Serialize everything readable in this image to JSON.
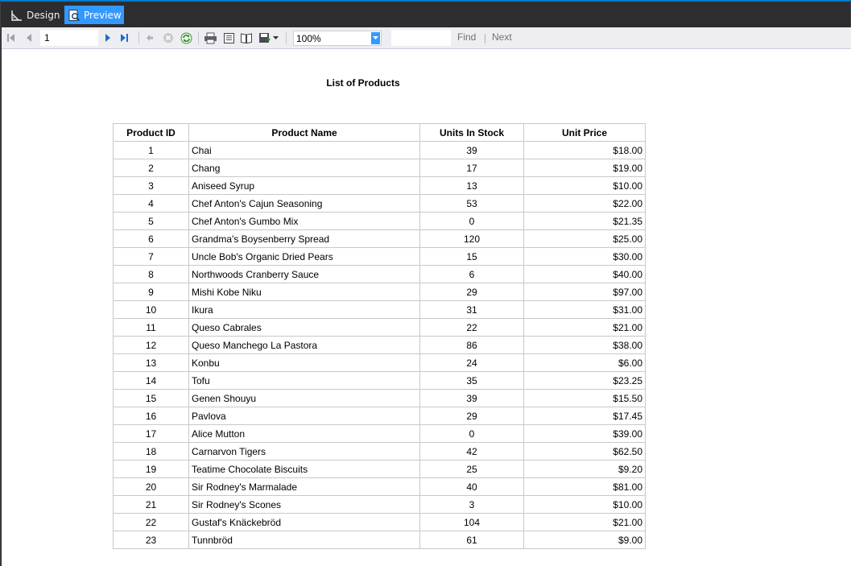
{
  "modes": {
    "design_label": "Design",
    "preview_label": "Preview"
  },
  "toolbar": {
    "page_value": "1",
    "zoom_value": "100%",
    "find_label": "Find",
    "next_label": "Next",
    "accent": "#3399ff"
  },
  "report": {
    "title": "List of Products",
    "columns": [
      "Product ID",
      "Product Name",
      "Units In Stock",
      "Unit Price"
    ],
    "rows": [
      {
        "id": "1",
        "name": "Chai",
        "stock": "39",
        "price": "$18.00"
      },
      {
        "id": "2",
        "name": "Chang",
        "stock": "17",
        "price": "$19.00"
      },
      {
        "id": "3",
        "name": "Aniseed Syrup",
        "stock": "13",
        "price": "$10.00"
      },
      {
        "id": "4",
        "name": "Chef Anton's Cajun Seasoning",
        "stock": "53",
        "price": "$22.00"
      },
      {
        "id": "5",
        "name": "Chef Anton's Gumbo Mix",
        "stock": "0",
        "price": "$21.35"
      },
      {
        "id": "6",
        "name": "Grandma's Boysenberry Spread",
        "stock": "120",
        "price": "$25.00"
      },
      {
        "id": "7",
        "name": "Uncle Bob's Organic Dried Pears",
        "stock": "15",
        "price": "$30.00"
      },
      {
        "id": "8",
        "name": "Northwoods Cranberry Sauce",
        "stock": "6",
        "price": "$40.00"
      },
      {
        "id": "9",
        "name": "Mishi Kobe Niku",
        "stock": "29",
        "price": "$97.00"
      },
      {
        "id": "10",
        "name": "Ikura",
        "stock": "31",
        "price": "$31.00"
      },
      {
        "id": "11",
        "name": "Queso Cabrales",
        "stock": "22",
        "price": "$21.00"
      },
      {
        "id": "12",
        "name": "Queso Manchego La Pastora",
        "stock": "86",
        "price": "$38.00"
      },
      {
        "id": "13",
        "name": "Konbu",
        "stock": "24",
        "price": "$6.00"
      },
      {
        "id": "14",
        "name": "Tofu",
        "stock": "35",
        "price": "$23.25"
      },
      {
        "id": "15",
        "name": "Genen Shouyu",
        "stock": "39",
        "price": "$15.50"
      },
      {
        "id": "16",
        "name": "Pavlova",
        "stock": "29",
        "price": "$17.45"
      },
      {
        "id": "17",
        "name": "Alice Mutton",
        "stock": "0",
        "price": "$39.00"
      },
      {
        "id": "18",
        "name": "Carnarvon Tigers",
        "stock": "42",
        "price": "$62.50"
      },
      {
        "id": "19",
        "name": "Teatime Chocolate Biscuits",
        "stock": "25",
        "price": "$9.20"
      },
      {
        "id": "20",
        "name": "Sir Rodney's Marmalade",
        "stock": "40",
        "price": "$81.00"
      },
      {
        "id": "21",
        "name": "Sir Rodney's Scones",
        "stock": "3",
        "price": "$10.00"
      },
      {
        "id": "22",
        "name": "Gustaf's Knäckebröd",
        "stock": "104",
        "price": "$21.00"
      },
      {
        "id": "23",
        "name": "Tunnbröd",
        "stock": "61",
        "price": "$9.00"
      }
    ]
  }
}
